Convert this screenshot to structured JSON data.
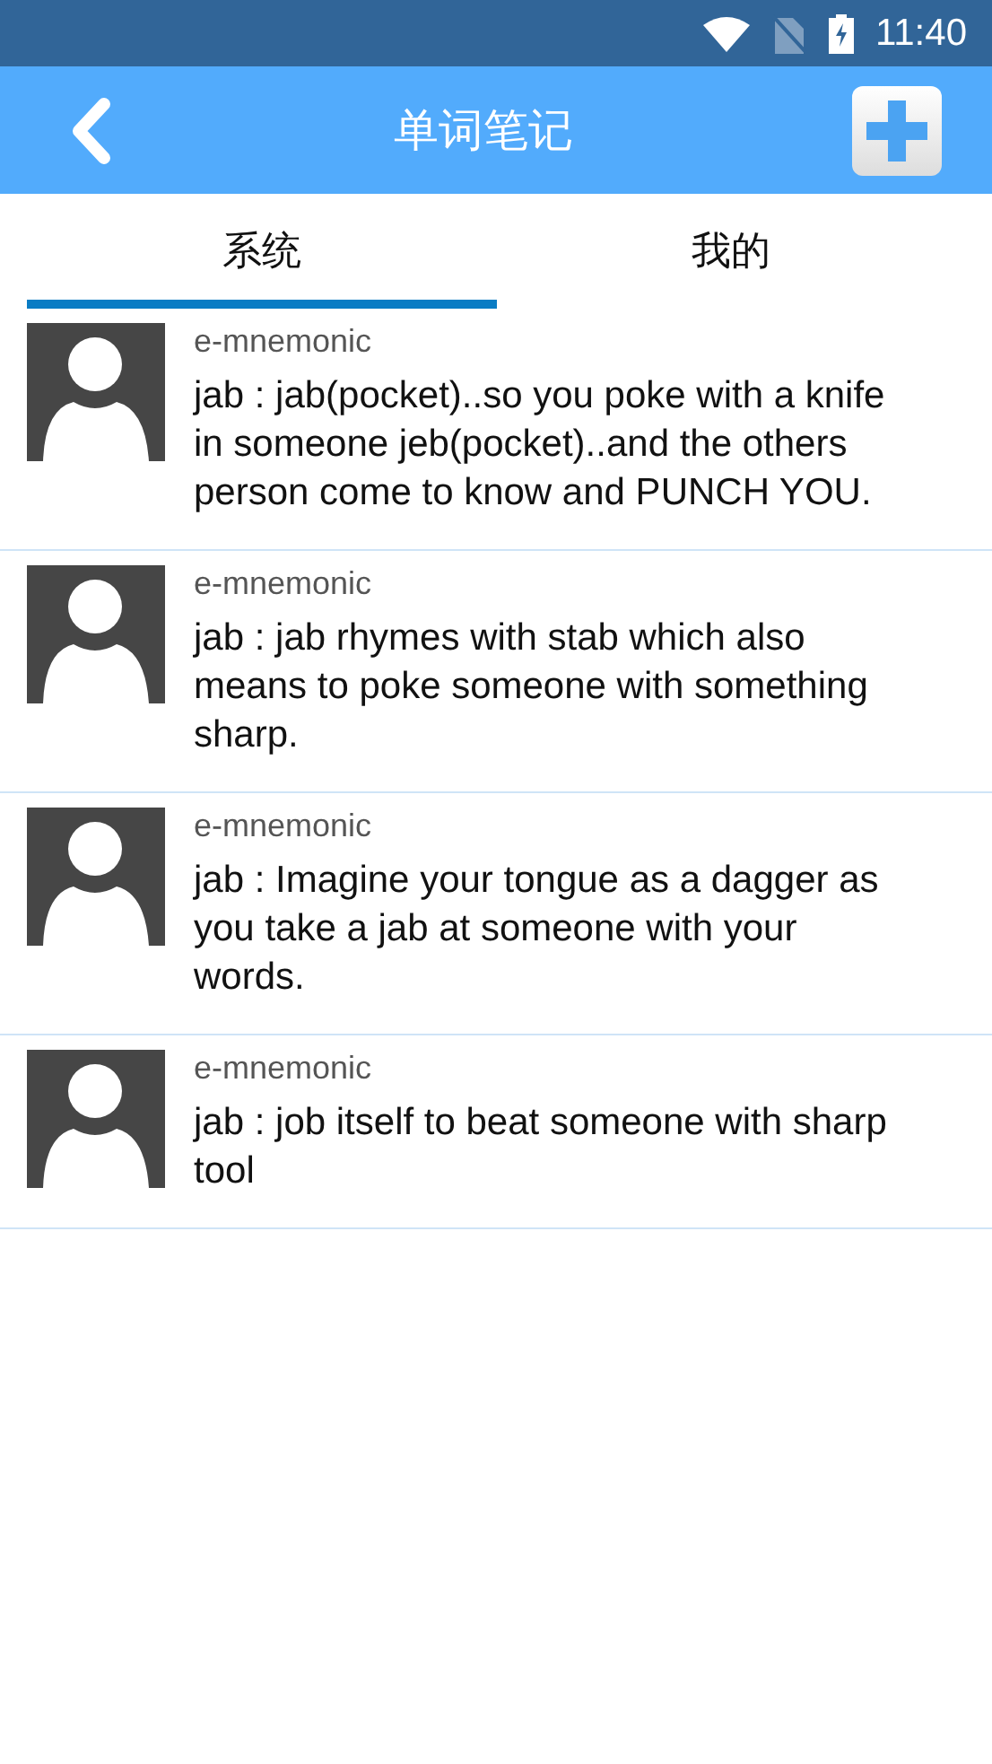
{
  "status_bar": {
    "time": "11:40"
  },
  "header": {
    "title": "单词笔记"
  },
  "tabs": [
    {
      "label": "系统",
      "selected": true
    },
    {
      "label": "我的",
      "selected": false
    }
  ],
  "notes": [
    {
      "author": "e-mnemonic",
      "text": "jab : jab(pocket)..so you poke with a knife in someone jeb(pocket)..and the others person come to know and PUNCH YOU."
    },
    {
      "author": "e-mnemonic",
      "text": "jab : jab rhymes with stab which also means to poke someone with something sharp."
    },
    {
      "author": "e-mnemonic",
      "text": "jab : Imagine your tongue as a dagger as you take a jab at someone with your words."
    },
    {
      "author": "e-mnemonic",
      "text": "jab : job itself to beat someone with sharp tool"
    }
  ]
}
